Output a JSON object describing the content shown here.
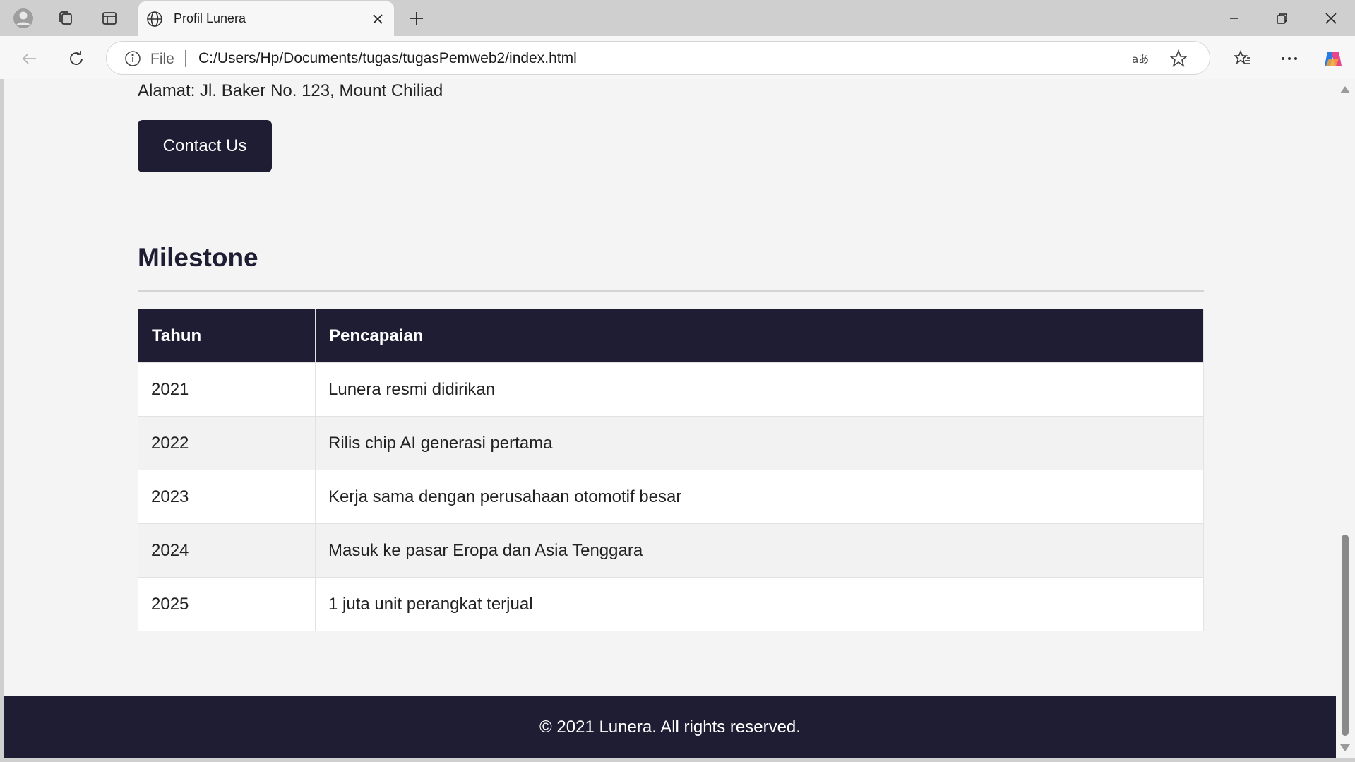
{
  "browser": {
    "tab": {
      "title": "Profil Lunera"
    },
    "address_bar": {
      "scheme_label": "File",
      "url": "C:/Users/Hp/Documents/tugas/tugasPemweb2/index.html"
    }
  },
  "page": {
    "address_text": "Alamat: Jl. Baker No. 123, Mount Chiliad",
    "contact_button": "Contact Us",
    "milestone": {
      "title": "Milestone",
      "headers": [
        "Tahun",
        "Pencapaian"
      ],
      "rows": [
        {
          "year": "2021",
          "achievement": "Lunera resmi didirikan"
        },
        {
          "year": "2022",
          "achievement": "Rilis chip AI generasi pertama"
        },
        {
          "year": "2023",
          "achievement": "Kerja sama dengan perusahaan otomotif besar"
        },
        {
          "year": "2024",
          "achievement": "Masuk ke pasar Eropa dan Asia Tenggara"
        },
        {
          "year": "2025",
          "achievement": "1 juta unit perangkat terjual"
        }
      ]
    },
    "footer": "© 2021 Lunera. All rights reserved."
  },
  "colors": {
    "brand_dark": "#1f1d33",
    "page_bg": "#f4f4f4",
    "row_alt": "#f2f2f2",
    "chrome": "#cfcfcf"
  }
}
